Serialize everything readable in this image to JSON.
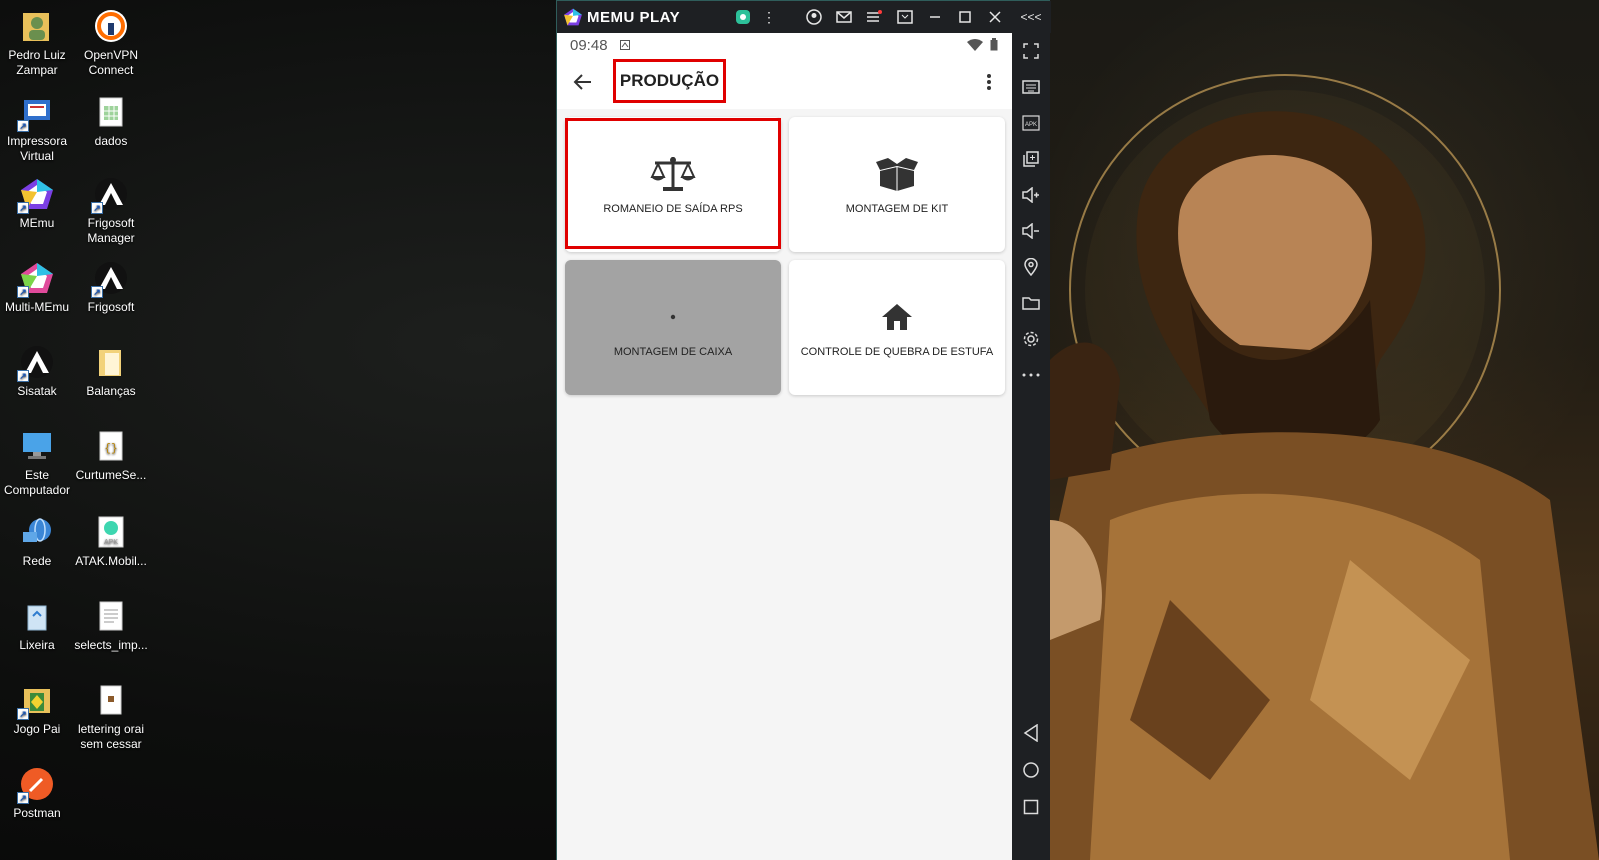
{
  "desktop": {
    "icons": [
      {
        "label": "Pedro Luiz Zampar"
      },
      {
        "label": "OpenVPN Connect"
      },
      {
        "label": "Impressora Virtual"
      },
      {
        "label": "dados"
      },
      {
        "label": "MEmu"
      },
      {
        "label": "Frigosoft Manager"
      },
      {
        "label": "Multi-MEmu"
      },
      {
        "label": "Frigosoft"
      },
      {
        "label": "Sisatak"
      },
      {
        "label": "Balanças"
      },
      {
        "label": "Este Computador"
      },
      {
        "label": "CurtumeSe..."
      },
      {
        "label": "Rede"
      },
      {
        "label": "ATAK.Mobil..."
      },
      {
        "label": "Lixeira"
      },
      {
        "label": "selects_imp..."
      },
      {
        "label": "Jogo Pai"
      },
      {
        "label": "lettering orai sem cessar"
      },
      {
        "label": "Postman"
      }
    ]
  },
  "emulator": {
    "brand": "MEMU PLAY",
    "collapse_label": "<<<"
  },
  "android": {
    "status": {
      "time": "09:48"
    },
    "app_bar": {
      "title": "PRODUÇÃO"
    },
    "tiles": [
      {
        "label": "ROMANEIO DE SAÍDA RPS",
        "icon": "scale-icon",
        "enabled": true
      },
      {
        "label": "MONTAGEM DE KIT",
        "icon": "open-box-icon",
        "enabled": true
      },
      {
        "label": "MONTAGEM DE CAIXA",
        "icon": "dot-icon",
        "enabled": false
      },
      {
        "label": "CONTROLE DE QUEBRA DE ESTUFA",
        "icon": "home-icon",
        "enabled": true
      }
    ]
  },
  "colors": {
    "highlight": "#e00000",
    "emu_frame": "#1e2023",
    "tile_disabled": "#a3a3a3"
  }
}
